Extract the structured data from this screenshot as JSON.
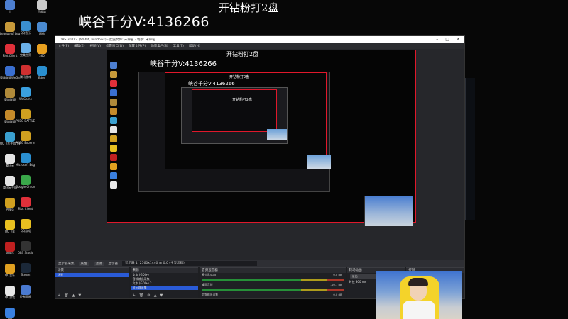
{
  "overlay": {
    "top_text": "开钻粉打2盘",
    "streamer_text": "峡谷千分V:4136266"
  },
  "desktop_icons": [
    {
      "label": "I",
      "color": "#4d7fd1"
    },
    {
      "label": "League of Legends",
      "color": "#c79a3a"
    },
    {
      "label": "Riot Client",
      "color": "#e0303a"
    },
    {
      "label": "英雄联盟WeGame版",
      "color": "#3a6fd0"
    },
    {
      "label": "英雄联盟",
      "color": "#b08a3a"
    },
    {
      "label": "英雄联盟",
      "color": "#c48a2a"
    },
    {
      "label": "QQ飞车手游工具",
      "color": "#3aa0d0"
    },
    {
      "label": "腾讯云",
      "color": "#e5e5e5"
    },
    {
      "label": "腾讯云手机",
      "color": "#e5e5e5"
    },
    {
      "label": "PUBG",
      "color": "#d0a020"
    },
    {
      "label": "QQ飞车",
      "color": "#e8c020"
    },
    {
      "label": "PUBG",
      "color": "#c02020"
    },
    {
      "label": "QQ音乐",
      "color": "#e0a020"
    },
    {
      "label": "QQ游戏",
      "color": "#e8e8e8"
    },
    {
      "label": "QQ",
      "color": "#3a80e0"
    }
  ],
  "desktop_icons_col2": [
    {
      "label": "QQ音乐",
      "color": "#3a8fd0"
    },
    {
      "label": "完美世界",
      "color": "#6ab0e8"
    },
    {
      "label": "腾讯游戏",
      "color": "#d03030"
    },
    {
      "label": "WeGame",
      "color": "#3aa0e0"
    },
    {
      "label": "PUBG BATTLEGR...",
      "color": "#d0a020"
    },
    {
      "label": "PUBG Experime...",
      "color": "#d0a020"
    },
    {
      "label": "Microsoft Edge",
      "color": "#2a8fd0"
    },
    {
      "label": "Google Chrome",
      "color": "#3aa84a"
    },
    {
      "label": "Riot Client",
      "color": "#e0303a"
    },
    {
      "label": "QQ游戏",
      "color": "#e8c020"
    },
    {
      "label": "OBS Studio",
      "color": "#333333"
    },
    {
      "label": "Steam",
      "color": "#1b2838"
    },
    {
      "label": "控制面板",
      "color": "#4a7ad0"
    }
  ],
  "desktop_icons_col3": [
    {
      "label": "回收站",
      "color": "#cccccc"
    },
    {
      "label": "网络",
      "color": "#4a8ad0"
    },
    {
      "label": "360",
      "color": "#e8a020"
    },
    {
      "label": "Edge",
      "color": "#2a8fd0"
    }
  ],
  "obs": {
    "title": "OBS 30.0.2 (64-bit, windows) - 配置文件: 未命名 - 场景: 未命名",
    "menu": [
      "文件(F)",
      "编辑(E)",
      "视图(V)",
      "停靠窗口(D)",
      "配置文件(P)",
      "场景集合(S)",
      "工具(T)",
      "帮助(H)"
    ],
    "scenebar": {
      "label": "显示器采集",
      "btn1": "属性",
      "btn2": "滤镜",
      "field_label": "显示器",
      "field_value": "显示器 1: 2560x1440 @ 0,0 (主显示器)"
    },
    "docks": {
      "scenes": {
        "title": "场景",
        "items": [
          "场景"
        ]
      },
      "sources": {
        "title": "来源",
        "items": [
          "文本 (GDI+)",
          "音频输出采集",
          "文本 (GDI+) 2",
          "显示器采集"
        ]
      },
      "mixer": {
        "title": "音频混音器",
        "channels": [
          {
            "name": "麦克风/Aux",
            "db": "0.0 dB"
          },
          {
            "name": "桌面音频",
            "db": "-10.7 dB"
          },
          {
            "name": "音频输出采集",
            "db": "0.0 dB"
          }
        ]
      },
      "transitions": {
        "title": "转场动画",
        "type": "淡出",
        "duration_label": "时长",
        "duration": "300 ms"
      },
      "controls": {
        "title": "控制",
        "buttons": [
          "停止推流",
          "开始录制",
          "启动虚拟摄像机"
        ]
      }
    },
    "status": "LIVE: 00:00:00   REC"
  }
}
